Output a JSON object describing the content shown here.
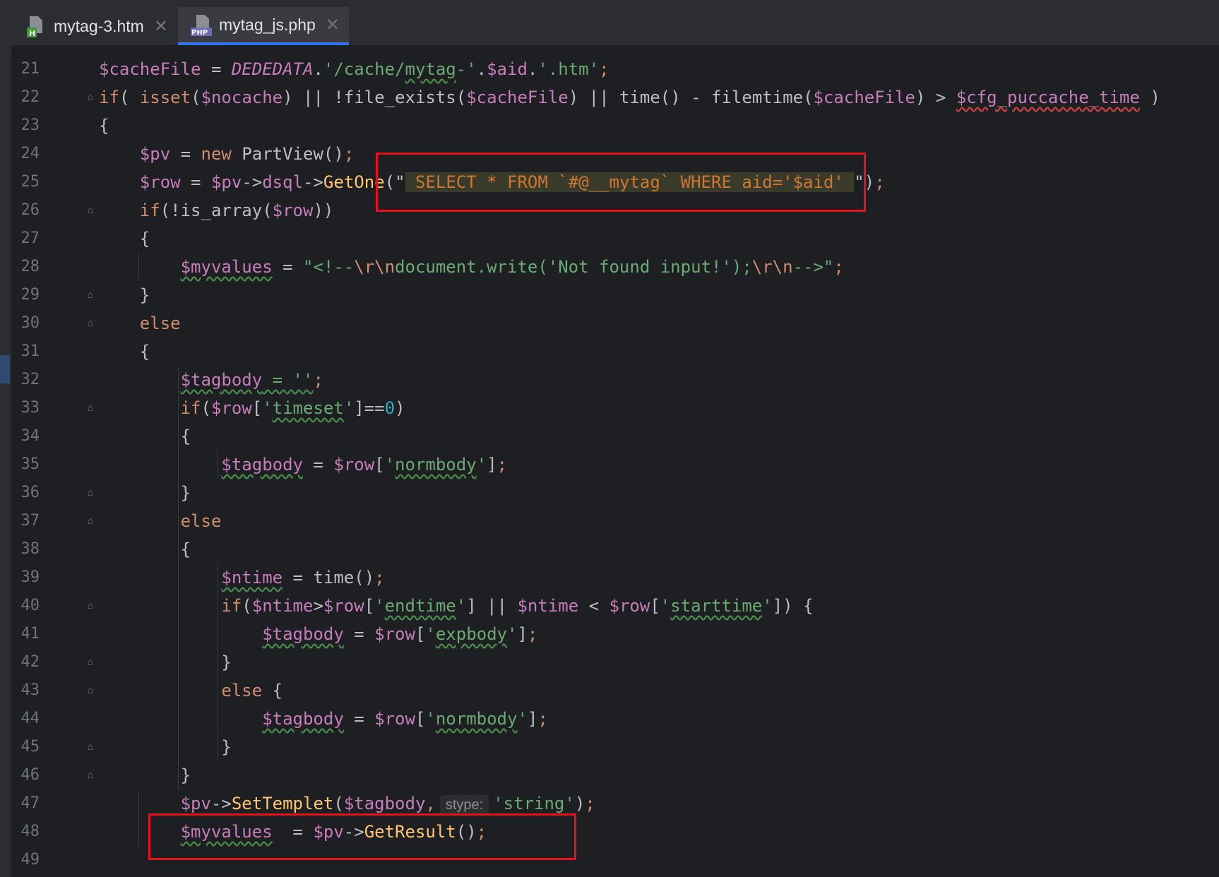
{
  "tabs": [
    {
      "label": "mytag-3.htm",
      "icon": "html-file-icon",
      "active": false
    },
    {
      "label": "mytag_js.php",
      "icon": "php-file-icon",
      "active": true
    }
  ],
  "lines": [
    {
      "n": "21",
      "tokens": [
        [
          "v",
          "$cacheFile"
        ],
        [
          "p",
          " = "
        ],
        [
          "c",
          "DEDEDATA"
        ],
        [
          "p",
          "."
        ],
        [
          "s",
          "'/cache/"
        ],
        [
          "suw",
          "mytag"
        ],
        [
          "s",
          "-'"
        ],
        [
          "p",
          "."
        ],
        [
          "v",
          "$aid"
        ],
        [
          "p",
          "."
        ],
        [
          "s",
          "'.htm'"
        ],
        [
          "k",
          ";"
        ]
      ]
    },
    {
      "n": "22",
      "tokens": [
        [
          "k",
          "if"
        ],
        [
          "p",
          "( "
        ],
        [
          "k",
          "isset"
        ],
        [
          "p",
          "("
        ],
        [
          "v",
          "$nocache"
        ],
        [
          "p",
          ") || !"
        ],
        [
          "p",
          "file_exists"
        ],
        [
          "p",
          "("
        ],
        [
          "v",
          "$cacheFile"
        ],
        [
          "p",
          ") || "
        ],
        [
          "p",
          "time"
        ],
        [
          "p",
          "() - "
        ],
        [
          "p",
          "filemtime"
        ],
        [
          "p",
          "("
        ],
        [
          "v",
          "$cacheFile"
        ],
        [
          "p",
          ") > "
        ],
        [
          "vuwr",
          "$cfg_puccache_time"
        ],
        [
          "p",
          " )"
        ]
      ]
    },
    {
      "n": "23",
      "tokens": [
        [
          "p",
          "{"
        ]
      ]
    },
    {
      "n": "24",
      "tokens": [
        [
          "p",
          "    "
        ],
        [
          "v",
          "$pv"
        ],
        [
          "p",
          " = "
        ],
        [
          "k",
          "new "
        ],
        [
          "p",
          "PartView"
        ],
        [
          "p",
          "()"
        ],
        [
          "k",
          ";"
        ]
      ]
    },
    {
      "n": "25",
      "tokens": [
        [
          "p",
          "    "
        ],
        [
          "v",
          "$row"
        ],
        [
          "p",
          " = "
        ],
        [
          "v",
          "$pv"
        ],
        [
          "p",
          "->"
        ],
        [
          "v",
          "dsql"
        ],
        [
          "p",
          "->"
        ],
        [
          "m",
          "GetOne"
        ],
        [
          "p",
          "(\""
        ],
        [
          "sqlbg",
          " SELECT * FROM `#@__mytag` WHERE aid='$aid' "
        ],
        [
          "p",
          "\")"
        ],
        [
          "k",
          ";"
        ]
      ]
    },
    {
      "n": "26",
      "tokens": [
        [
          "p",
          "    "
        ],
        [
          "k",
          "if"
        ],
        [
          "p",
          "(!"
        ],
        [
          "p",
          "is_array"
        ],
        [
          "p",
          "("
        ],
        [
          "v",
          "$row"
        ],
        [
          "p",
          "))"
        ]
      ]
    },
    {
      "n": "27",
      "tokens": [
        [
          "p",
          "    {"
        ]
      ]
    },
    {
      "n": "28",
      "tokens": [
        [
          "p",
          "        "
        ],
        [
          "vuw",
          "$myvalues"
        ],
        [
          "p",
          " = "
        ],
        [
          "s",
          "\"<!--"
        ],
        [
          "k",
          "\\r\\n"
        ],
        [
          "s",
          "document.write('Not found input!');"
        ],
        [
          "k",
          "\\r\\n"
        ],
        [
          "s",
          "-->\""
        ],
        [
          "k",
          ";"
        ]
      ]
    },
    {
      "n": "29",
      "tokens": [
        [
          "p",
          "    }"
        ]
      ]
    },
    {
      "n": "30",
      "tokens": [
        [
          "p",
          "    "
        ],
        [
          "k",
          "else"
        ]
      ]
    },
    {
      "n": "31",
      "tokens": [
        [
          "p",
          "    {"
        ]
      ]
    },
    {
      "n": "32",
      "tokens": [
        [
          "p",
          "        "
        ],
        [
          "vuw",
          "$tagbody"
        ],
        [
          "suw",
          " = ''"
        ],
        [
          "k",
          ";"
        ]
      ]
    },
    {
      "n": "33",
      "tokens": [
        [
          "p",
          "        "
        ],
        [
          "k",
          "if"
        ],
        [
          "p",
          "("
        ],
        [
          "v",
          "$row"
        ],
        [
          "p",
          "["
        ],
        [
          "s",
          "'"
        ],
        [
          "suw",
          "timeset"
        ],
        [
          "s",
          "'"
        ],
        [
          "p",
          "]=="
        ],
        [
          "n",
          "0"
        ],
        [
          "p",
          ")"
        ]
      ]
    },
    {
      "n": "34",
      "tokens": [
        [
          "p",
          "        {"
        ]
      ]
    },
    {
      "n": "35",
      "tokens": [
        [
          "p",
          "            "
        ],
        [
          "vuw",
          "$tagbody"
        ],
        [
          "p",
          " = "
        ],
        [
          "v",
          "$row"
        ],
        [
          "p",
          "["
        ],
        [
          "s",
          "'"
        ],
        [
          "suw",
          "normbody"
        ],
        [
          "s",
          "'"
        ],
        [
          "p",
          "]"
        ],
        [
          "k",
          ";"
        ]
      ]
    },
    {
      "n": "36",
      "tokens": [
        [
          "p",
          "        }"
        ]
      ]
    },
    {
      "n": "37",
      "tokens": [
        [
          "p",
          "        "
        ],
        [
          "k",
          "else"
        ]
      ]
    },
    {
      "n": "38",
      "tokens": [
        [
          "p",
          "        {"
        ]
      ]
    },
    {
      "n": "39",
      "tokens": [
        [
          "p",
          "            "
        ],
        [
          "vuw",
          "$ntime"
        ],
        [
          "p",
          " = "
        ],
        [
          "p",
          "time"
        ],
        [
          "p",
          "()"
        ],
        [
          "k",
          ";"
        ]
      ]
    },
    {
      "n": "40",
      "tokens": [
        [
          "p",
          "            "
        ],
        [
          "k",
          "if"
        ],
        [
          "p",
          "("
        ],
        [
          "v",
          "$ntime"
        ],
        [
          "p",
          ">"
        ],
        [
          "v",
          "$row"
        ],
        [
          "p",
          "["
        ],
        [
          "s",
          "'"
        ],
        [
          "suw",
          "endtime"
        ],
        [
          "s",
          "'"
        ],
        [
          "p",
          "] || "
        ],
        [
          "v",
          "$ntime"
        ],
        [
          "p",
          " < "
        ],
        [
          "v",
          "$row"
        ],
        [
          "p",
          "["
        ],
        [
          "s",
          "'"
        ],
        [
          "suw",
          "starttime"
        ],
        [
          "s",
          "'"
        ],
        [
          "p",
          "]) {"
        ]
      ]
    },
    {
      "n": "41",
      "tokens": [
        [
          "p",
          "                "
        ],
        [
          "vuw",
          "$tagbody"
        ],
        [
          "p",
          " = "
        ],
        [
          "v",
          "$row"
        ],
        [
          "p",
          "["
        ],
        [
          "s",
          "'"
        ],
        [
          "suw",
          "expbody"
        ],
        [
          "s",
          "'"
        ],
        [
          "p",
          "]"
        ],
        [
          "k",
          ";"
        ]
      ]
    },
    {
      "n": "42",
      "tokens": [
        [
          "p",
          "            }"
        ]
      ]
    },
    {
      "n": "43",
      "tokens": [
        [
          "p",
          "            "
        ],
        [
          "k",
          "else"
        ],
        [
          "p",
          " {"
        ]
      ]
    },
    {
      "n": "44",
      "tokens": [
        [
          "p",
          "                "
        ],
        [
          "vuw",
          "$tagbody"
        ],
        [
          "p",
          " = "
        ],
        [
          "v",
          "$row"
        ],
        [
          "p",
          "["
        ],
        [
          "s",
          "'"
        ],
        [
          "suw",
          "normbody"
        ],
        [
          "s",
          "'"
        ],
        [
          "p",
          "]"
        ],
        [
          "k",
          ";"
        ]
      ]
    },
    {
      "n": "45",
      "tokens": [
        [
          "p",
          "            }"
        ]
      ]
    },
    {
      "n": "46",
      "tokens": [
        [
          "p",
          "        }"
        ]
      ]
    },
    {
      "n": "47",
      "tokens": [
        [
          "p",
          "        "
        ],
        [
          "v",
          "$pv"
        ],
        [
          "p",
          "->"
        ],
        [
          "m",
          "SetTemplet"
        ],
        [
          "p",
          "("
        ],
        [
          "v",
          "$tagbody"
        ],
        [
          "k",
          ","
        ],
        [
          "hint",
          "stype:"
        ],
        [
          "s",
          "'string'"
        ],
        [
          "p",
          ")"
        ],
        [
          "k",
          ";"
        ]
      ]
    },
    {
      "n": "48",
      "tokens": [
        [
          "p",
          "        "
        ],
        [
          "vuw",
          "$myvalues"
        ],
        [
          "p",
          "  = "
        ],
        [
          "v",
          "$pv"
        ],
        [
          "p",
          "->"
        ],
        [
          "m",
          "GetResult"
        ],
        [
          "p",
          "()"
        ],
        [
          "k",
          ";"
        ]
      ]
    },
    {
      "n": "49",
      "tokens": []
    }
  ]
}
